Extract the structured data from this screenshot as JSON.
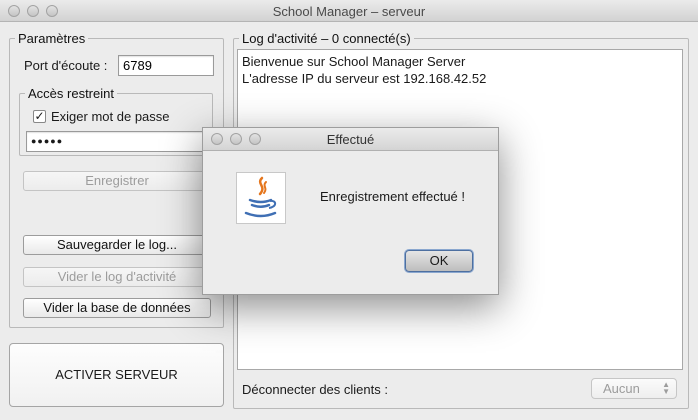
{
  "window": {
    "title": "School Manager – serveur"
  },
  "params": {
    "legend": "Paramètres",
    "port_label": "Port d'écoute :",
    "port_value": "6789",
    "restricted_legend": "Accès restreint",
    "require_password_label": "Exiger mot de passe",
    "require_password_checked": true,
    "password_masked": "●●●●●",
    "save_button": "Enregistrer",
    "save_log_button": "Sauvegarder le log...",
    "clear_log_button": "Vider le log d'activité",
    "clear_db_button": "Vider la base de données"
  },
  "server_button": "ACTIVER SERVEUR",
  "log": {
    "legend": "Log d'activité – 0 connecté(s)",
    "lines": [
      "Bienvenue sur School Manager Server",
      "L'adresse IP du serveur est 192.168.42.52"
    ],
    "disconnect_label": "Déconnecter des clients :",
    "clients_select_value": "Aucun"
  },
  "dialog": {
    "title": "Effectué",
    "message": "Enregistrement effectué !",
    "ok_button": "OK",
    "icon": "java-icon"
  },
  "colors": {
    "window_bg": "#ececec",
    "ok_button_focus": "#8aa7cf",
    "disabled_text": "#9c9c9c",
    "java_cup_blue": "#3f6fb4",
    "java_flame_orange": "#e5761d"
  }
}
